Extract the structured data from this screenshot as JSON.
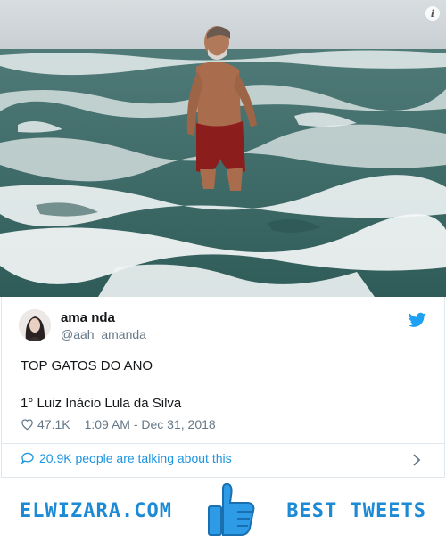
{
  "tweet": {
    "author_name": "ama nda",
    "author_handle": "@aah_amanda",
    "text_line1": "TOP GATOS DO ANO",
    "text_line2": "1° Luiz Inácio Lula da Silva",
    "likes": "47.1K",
    "timestamp": "1:09 AM - Dec 31, 2018",
    "talking": "20.9K people are talking about this"
  },
  "icons": {
    "info": "info-icon",
    "bird": "twitter-bird-icon",
    "heart": "heart-icon",
    "bubble": "comment-bubble-icon",
    "chevron": "chevron-right-icon",
    "thumb": "thumbs-up-icon"
  },
  "banner": {
    "site": "ELWIZARA.COM",
    "tagline": "BEST TWEETS"
  },
  "colors": {
    "twitter_blue": "#1da1f2",
    "link_blue": "#1b95e0",
    "banner_blue": "#1c8ad4",
    "muted": "#657786"
  }
}
